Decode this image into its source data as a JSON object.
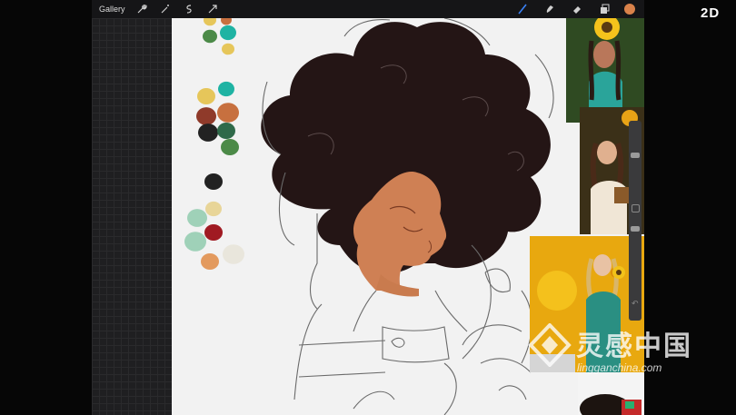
{
  "toolbar": {
    "gallery_label": "Gallery",
    "left_tools": [
      "wrench-icon",
      "magic-wand-icon",
      "selection-icon",
      "transform-arrow-icon"
    ],
    "right_tools": [
      "brush-icon",
      "smudge-icon",
      "eraser-icon",
      "layers-icon"
    ],
    "active_color": "#d9824a"
  },
  "palette": {
    "swatches": [
      "#e6c65a",
      "#c7703f",
      "#4c8a48",
      "#1fb3a3",
      "#8f3a2a",
      "#2f6a4a",
      "#222222",
      "#e8d598",
      "#9fd1b8",
      "#a01a22",
      "#e39a5e",
      "#e9e6dc"
    ]
  },
  "colors": {
    "hair": "#241515",
    "skin": "#cf8054",
    "canvas": "#f2f2f2",
    "sketch_line": "#6a6a6a",
    "accent_blue": "#3a82f7"
  },
  "branding": {
    "top_right_logo": "2D",
    "watermark_cn": "灵感中国",
    "watermark_en": "lingganchina.com"
  }
}
